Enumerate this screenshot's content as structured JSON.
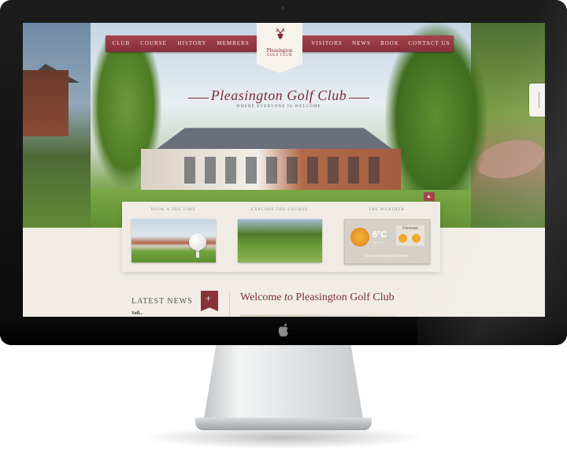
{
  "nav": {
    "left_items": [
      "CLUB",
      "COURSE",
      "HISTORY",
      "MEMBERS"
    ],
    "right_items": [
      "VISITORS",
      "NEWS",
      "BOOK",
      "CONTACT US"
    ]
  },
  "logo": {
    "name": "Pleasington",
    "sub": "GOLF CLUB"
  },
  "hero": {
    "title": "Pleasington Golf Club",
    "tagline": "WHERE EVERYONE IS WELCOME"
  },
  "features": [
    {
      "label": "BOOK A TEE TIME"
    },
    {
      "label": "EXPLORE THE COURSE"
    },
    {
      "label": "THE WEATHER"
    }
  ],
  "weather": {
    "temp": "6°C",
    "date": "SAT 24",
    "forecast_label": "Forecast",
    "link": "Get a more detailed forecast"
  },
  "news": {
    "heading": "LATEST NEWS",
    "badge": "+",
    "first_item": "Voll..."
  },
  "welcome": {
    "prefix": "Welcome",
    "emphasis": "to",
    "suffix": "Pleasington Golf Club"
  },
  "icons": {
    "logo": "stag-icon",
    "scroll": "chevron-up-icon",
    "weather": "sun-icon",
    "brand": "apple-icon"
  },
  "colors": {
    "accent": "#8a3039",
    "nav": "#a5434d",
    "background": "#f1ede6"
  }
}
